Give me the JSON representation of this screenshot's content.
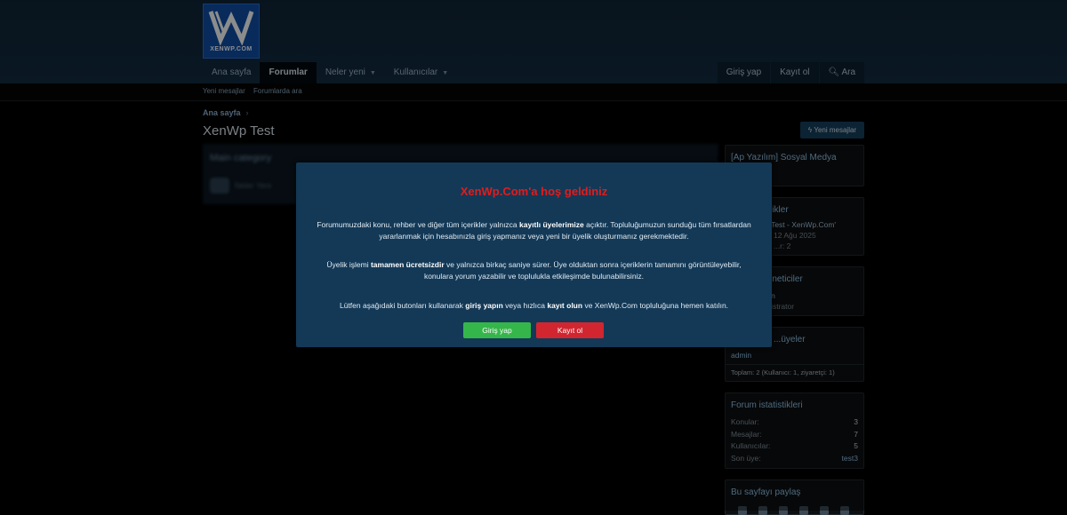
{
  "brand": {
    "logo_text": "XENWP.COM"
  },
  "nav": {
    "items": [
      {
        "label": "Ana sayfa"
      },
      {
        "label": "Forumlar"
      },
      {
        "label": "Neler yeni"
      },
      {
        "label": "Kullanıcılar"
      }
    ],
    "login": "Giriş yap",
    "register": "Kayıt ol",
    "search": "Ara"
  },
  "subnav": {
    "new_posts": "Yeni mesajlar",
    "search_forums": "Forumlarda ara"
  },
  "breadcrumb": {
    "home": "Ana sayfa",
    "sep": "›"
  },
  "page": {
    "title": "XenWp Test",
    "new_posts_button": "Yeni mesajlar"
  },
  "main": {
    "category": "Main category",
    "node": "Neler Yeni"
  },
  "sidebar": {
    "social": {
      "title": "[Ap Yazılım] Sosyal Medya"
    },
    "latest": {
      "title": "...ikler",
      "thread": "...Test - XenWp.Com'",
      "date": "12 Ağu 2025",
      "replies": "...r: 2"
    },
    "staff": {
      "title": "...neticiler",
      "user": "...n",
      "role": "...istrator"
    },
    "online": {
      "title": "...üyeler",
      "user": "admin",
      "total": "Toplam: 2 (Kullanıcı: 1, ziyaretçi: 1)"
    },
    "stats": {
      "title": "Forum istatistikleri",
      "rows": [
        {
          "label": "Konular:",
          "value": "3"
        },
        {
          "label": "Mesajlar:",
          "value": "7"
        },
        {
          "label": "Kullanıcılar:",
          "value": "5"
        },
        {
          "label": "Son üye:",
          "value": "test3"
        }
      ]
    },
    "share": {
      "title": "Bu sayfayı paylaş"
    }
  },
  "modal": {
    "title": "XenWp.Com'a hoş geldiniz",
    "p1_a": "Forumumuzdaki konu, rehber ve diğer tüm içerikler yalnızca ",
    "p1_b": "kayıtlı üyelerimize",
    "p1_c": " açıktır. Topluluğumuzun sunduğu tüm fırsatlardan yararlanmak için hesabınızla giriş yapmanız veya yeni bir üyelik oluşturmanız gerekmektedir.",
    "p2_a": "Üyelik işlemi ",
    "p2_b": "tamamen ücretsizdir",
    "p2_c": " ve yalnızca birkaç saniye sürer. Üye olduktan sonra içeriklerin tamamını görüntüleyebilir, konulara yorum yazabilir ve toplulukla etkileşimde bulunabilirsiniz.",
    "p3_a": "Lütfen aşağıdaki butonları kullanarak ",
    "p3_b": "giriş yapın",
    "p3_c": " veya hızlıca ",
    "p3_d": "kayıt olun",
    "p3_e": " ve XenWp.Com topluluğuna hemen katılın.",
    "login_button": "Giriş yap",
    "register_button": "Kayıt ol"
  },
  "colors": {
    "modal_bg": "#133957",
    "title_red": "#e21c1c",
    "login_green": "#35b64a",
    "register_red": "#d12630"
  }
}
